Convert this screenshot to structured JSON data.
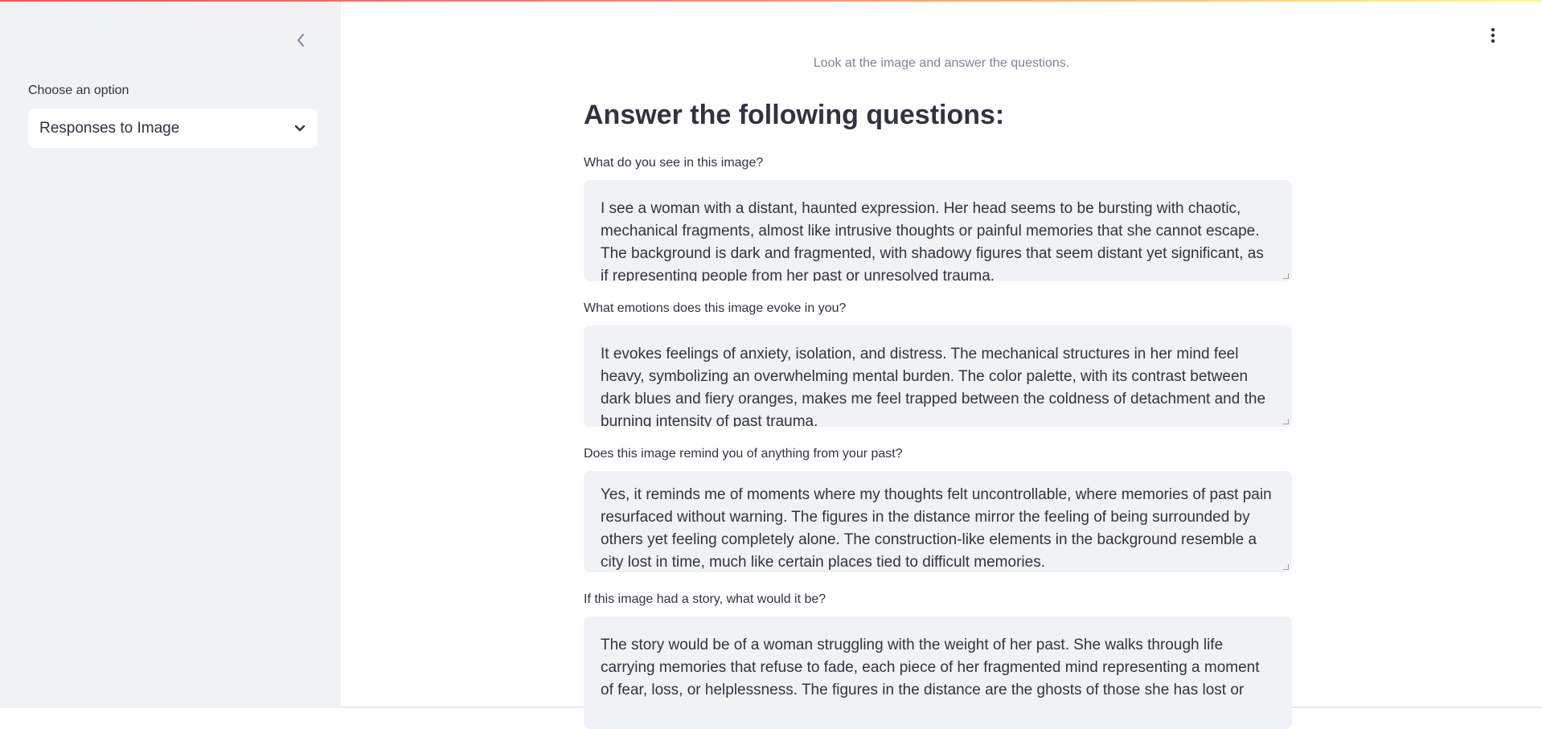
{
  "sidebar": {
    "select_label": "Choose an option",
    "select_value": "Responses to Image",
    "collapse_icon": "chevron-left-icon",
    "dropdown_icon": "chevron-down-icon"
  },
  "header": {
    "menu_icon": "vertical-dots-icon"
  },
  "main": {
    "caption": "Look at the image and answer the questions.",
    "heading": "Answer the following questions:",
    "questions": [
      {
        "label": "What do you see in this image?",
        "answer": "I see a woman with a distant, haunted expression. Her head seems to be bursting with chaotic, mechanical fragments, almost like intrusive thoughts or painful memories that she cannot escape. The background is dark and fragmented, with shadowy figures that seem distant yet significant, as if representing people from her past or unresolved trauma."
      },
      {
        "label": "What emotions does this image evoke in you?",
        "answer": "It evokes feelings of anxiety, isolation, and distress. The mechanical structures in her mind feel heavy, symbolizing an overwhelming mental burden. The color palette, with its contrast between dark blues and fiery oranges, makes me feel trapped between the coldness of detachment and the burning intensity of past trauma."
      },
      {
        "label": "Does this image remind you of anything from your past?",
        "answer": "Yes, it reminds me of moments where my thoughts felt uncontrollable, where memories of past pain resurfaced without warning. The figures in the distance mirror the feeling of being surrounded by others yet feeling completely alone. The construction-like elements in the background resemble a city lost in time, much like certain places tied to difficult memories."
      },
      {
        "label": "If this image had a story, what would it be?",
        "answer": "The story would be of a woman struggling with the weight of her past. She walks through life carrying memories that refuse to fade, each piece of her fragmented mind representing a moment of fear, loss, or helplessness. The figures in the distance are the ghosts of those she has lost or"
      }
    ]
  },
  "colors": {
    "sidebar_bg": "#f0f2f6",
    "text": "#31333f",
    "muted": "#808495",
    "accent_gradient_start": "#ff4b4b",
    "accent_gradient_end": "#fffd80"
  }
}
